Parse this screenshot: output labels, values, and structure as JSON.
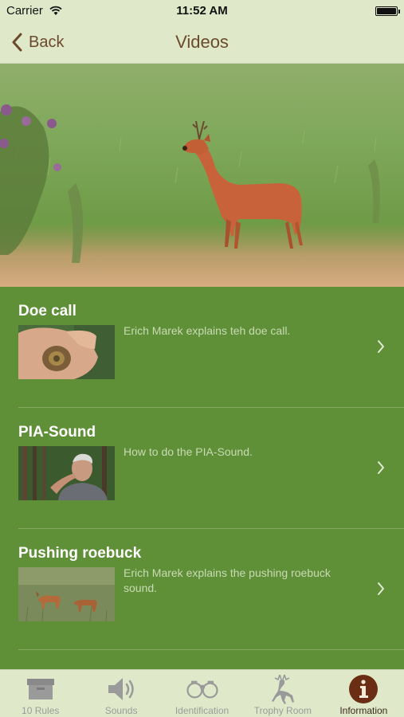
{
  "status": {
    "carrier": "Carrier",
    "time": "11:52 AM"
  },
  "nav": {
    "back_label": "Back",
    "title": "Videos"
  },
  "videos": [
    {
      "title": "Doe call",
      "description": "Erich Marek explains teh doe call."
    },
    {
      "title": "PIA-Sound",
      "description": "How to do the PIA-Sound."
    },
    {
      "title": "Pushing roebuck",
      "description": "Erich Marek explains the pushing roebuck sound."
    }
  ],
  "tabs": [
    {
      "label": "10 Rules",
      "icon": "box-icon"
    },
    {
      "label": "Sounds",
      "icon": "speaker-icon"
    },
    {
      "label": "Identification",
      "icon": "binoculars-icon"
    },
    {
      "label": "Trophy Room",
      "icon": "deer-icon"
    },
    {
      "label": "Information",
      "icon": "info-icon",
      "active": true
    }
  ],
  "colors": {
    "list_bg": "#5f8f37",
    "bar_bg": "#dfe9c9",
    "accent_brown": "#6b4a2c"
  }
}
